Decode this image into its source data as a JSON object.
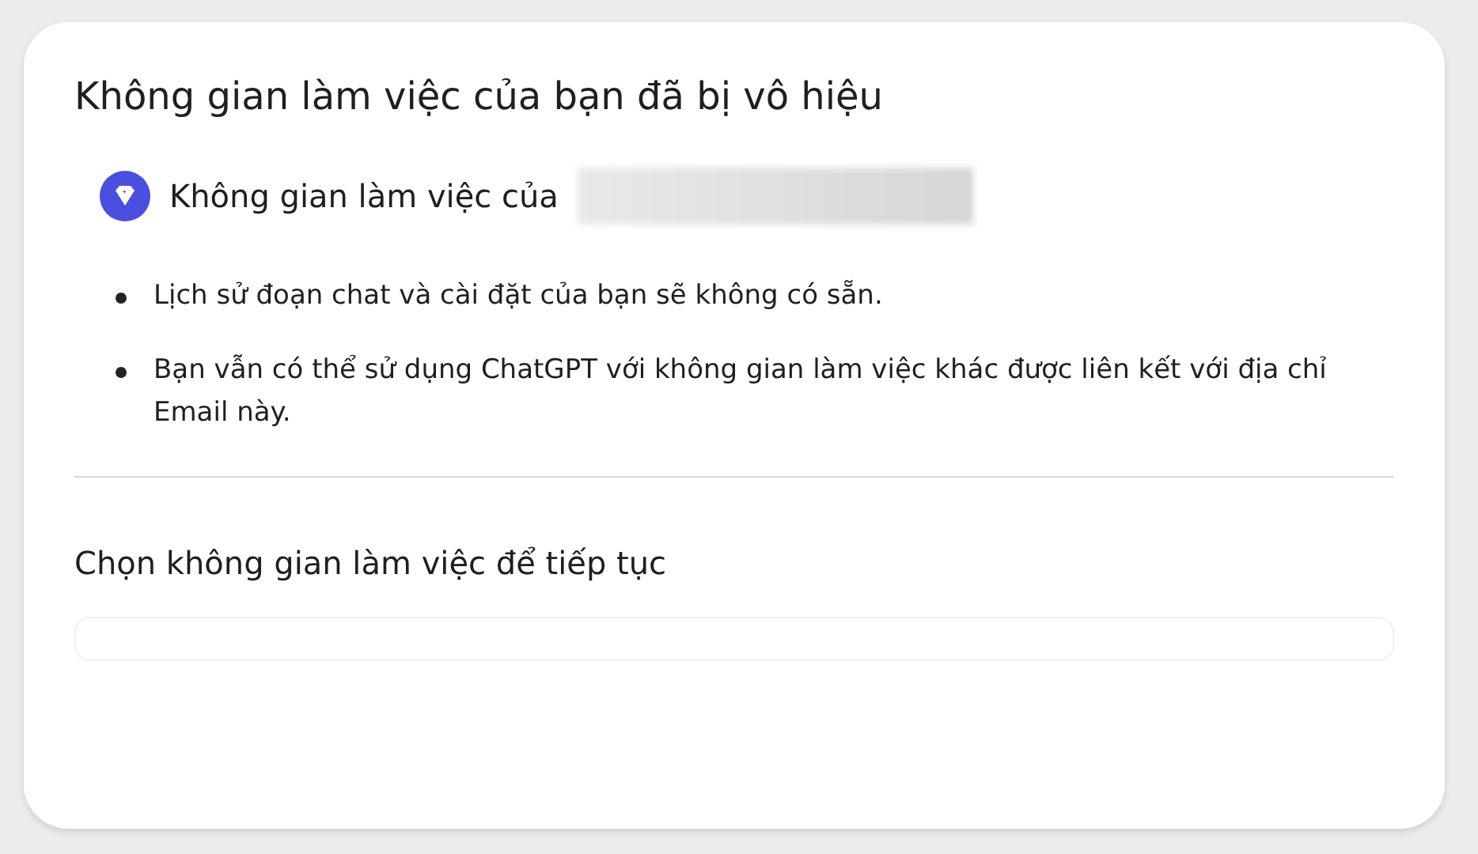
{
  "dialog": {
    "title": "Không gian làm việc của bạn đã bị vô hiệu",
    "workspace_label": "Không gian làm việc của",
    "notes": [
      "Lịch sử đoạn chat và cài đặt của bạn sẽ không có sẵn.",
      "Bạn vẫn có thể sử dụng ChatGPT với không gian làm việc khác được liên kết với địa chỉ Email này."
    ],
    "choose_label": "Chọn không gian làm việc để tiếp tục"
  }
}
